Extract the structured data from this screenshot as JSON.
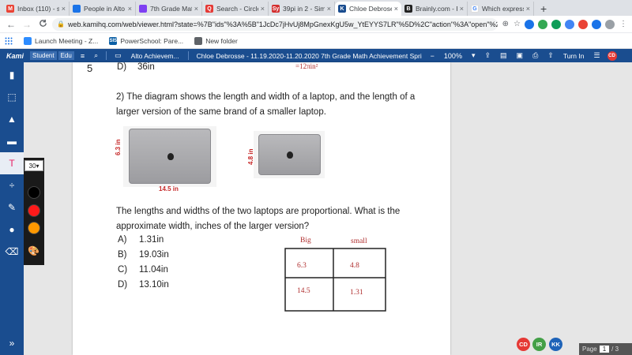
{
  "browser": {
    "tabs": [
      {
        "title": "Inbox (110) - st",
        "icon_color": "#ea4335",
        "icon_glyph": "M"
      },
      {
        "title": "People in Alto",
        "icon_color": "#1a73e8",
        "icon_glyph": ""
      },
      {
        "title": "7th Grade Math",
        "icon_color": "#7e3ff2",
        "icon_glyph": ""
      },
      {
        "title": "Search - Circle",
        "icon_color": "#e53935",
        "icon_glyph": "Q"
      },
      {
        "title": "39pi in 2 - Sim",
        "icon_color": "#d32f2f",
        "icon_glyph": "Sy"
      },
      {
        "title": "Chloe Debrose",
        "icon_color": "#1a4d8f",
        "icon_glyph": "K",
        "active": true
      },
      {
        "title": "Brainly.com - F",
        "icon_color": "#222222",
        "icon_glyph": "B"
      },
      {
        "title": "Which express",
        "icon_color": "#ffffff",
        "icon_glyph": "G"
      }
    ],
    "new_tab_symbol": "+",
    "url": "web.kamihq.com/web/viewer.html?state=%7B\"ids\"%3A%5B\"1JcDc7jHvUj8MpGnexKgU5w_YtEYYS7LR\"%5D%2C\"action\"%3A\"open\"%2C\"userI...",
    "nav": {
      "back": "←",
      "forward": "→",
      "reload": "C"
    },
    "bookmarks": [
      {
        "label": "Launch Meeting - Z...",
        "icon_color": "#2d8cff"
      },
      {
        "label": "PowerSchool: Pare...",
        "icon_color": "#0b5fa5",
        "icon_glyph": "SIS"
      },
      {
        "label": "New folder",
        "icon_color": "#5f6368"
      }
    ]
  },
  "kami": {
    "logo": "Kami",
    "role_student": "Student",
    "role_edu": "Edu",
    "breadcrumb": "Alto Achievem...",
    "doc_title": "Chloe Debrosse - 11.19.2020-11.20.2020 7th Grade Math Achievement Spri",
    "zoom_minus": "−",
    "zoom": "100%",
    "zoom_plus": "+",
    "turn_in": "Turn In",
    "user_initials": "CD",
    "font_size": "30",
    "colors": {
      "brand": "#1a4d8f",
      "black": "#000000",
      "red": "#ff1a1a",
      "orange": "#ff9800"
    }
  },
  "document": {
    "prev_item_number": "5",
    "prev_answer_letter": "D)",
    "prev_answer": "36in",
    "circle_label": "=12πin²",
    "question": "2)  The diagram shows the length and width of a laptop, and the length of a larger version of the same brand of a smaller laptop.",
    "big_laptop": {
      "height_label": "6.3 in",
      "width_label": "14.5 in"
    },
    "small_laptop": {
      "height_label": "4.8 in"
    },
    "prompt": "The lengths and widths of the two laptops are proportional. What is the approximate width, inches of the larger version?",
    "choices": [
      {
        "letter": "A)",
        "text": "1.31in"
      },
      {
        "letter": "B)",
        "text": "19.03in"
      },
      {
        "letter": "C)",
        "text": "11.04in"
      },
      {
        "letter": "D)",
        "text": "13.10in"
      }
    ],
    "annotation": {
      "col_big": "Big",
      "col_small": "small",
      "cells": [
        [
          "6.3",
          "4.8"
        ],
        [
          "14.5",
          "1.31"
        ]
      ]
    }
  },
  "collaborators": [
    {
      "initials": "CD",
      "color": "#e53935"
    },
    {
      "initials": "IR",
      "color": "#43a047"
    },
    {
      "initials": "KK",
      "color": "#1e63b8"
    }
  ],
  "pager": {
    "label": "Page",
    "current": "1",
    "total": "/ 3"
  }
}
